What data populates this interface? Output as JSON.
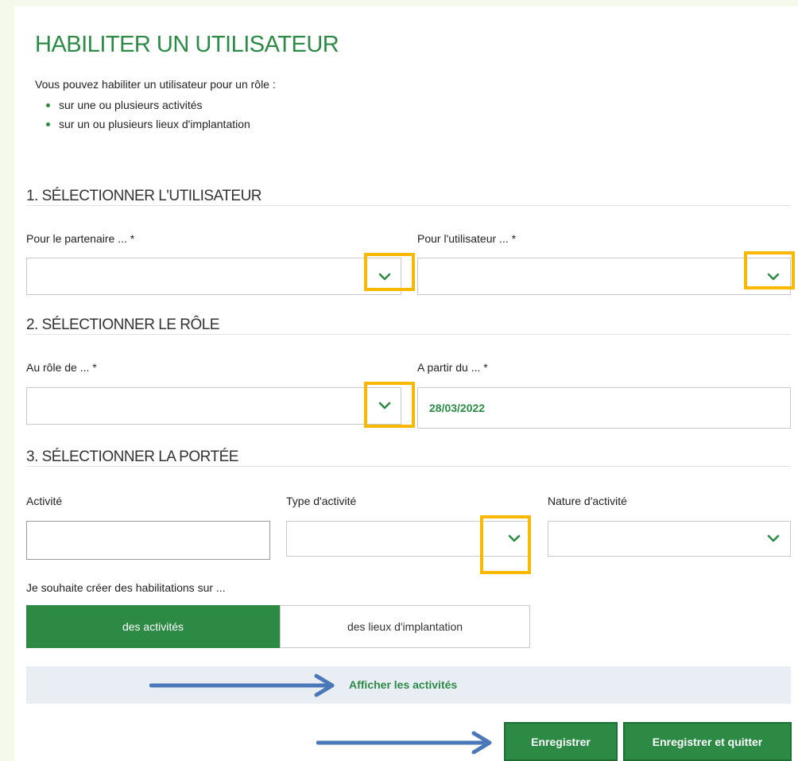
{
  "title": "HABILITER UN UTILISATEUR",
  "intro": {
    "text": "Vous pouvez habiliter un utilisateur pour un rôle :",
    "bullets": [
      "sur une ou plusieurs activités",
      "sur un ou plusieurs lieux d'implantation"
    ]
  },
  "sections": {
    "user": {
      "title": "1. SÉLECTIONNER L'UTILISATEUR",
      "partner_label": "Pour le partenaire ... *",
      "partner_value": "",
      "user_label": "Pour l'utilisateur ... *",
      "user_value": ""
    },
    "role": {
      "title": "2. SÉLECTIONNER LE RÔLE",
      "role_label": "Au rôle de ... *",
      "role_value": "",
      "date_label": "A partir du ... *",
      "date_value": "28/03/2022"
    },
    "scope": {
      "title": "3. SÉLECTIONNER LA PORTÉE",
      "activity_label": "Activité",
      "activity_value": "",
      "type_label": "Type d'activité",
      "type_value": "",
      "nature_label": "Nature d'activité",
      "nature_value": "",
      "create_label": "Je souhaite créer des habilitations sur ...",
      "toggle": {
        "option_activities": "des activités",
        "option_places": "des lieux d'implantation",
        "selected": "des activités"
      },
      "show_link": "Afficher les activités"
    }
  },
  "buttons": {
    "save": "Enregistrer",
    "save_quit": "Enregistrer et quitter"
  },
  "colors": {
    "accent": "#2c8a45",
    "highlight": "#f7b800",
    "annotation_arrow": "#4a78b8"
  },
  "icons": [
    "chevron-down-icon",
    "arrow-right-icon"
  ]
}
